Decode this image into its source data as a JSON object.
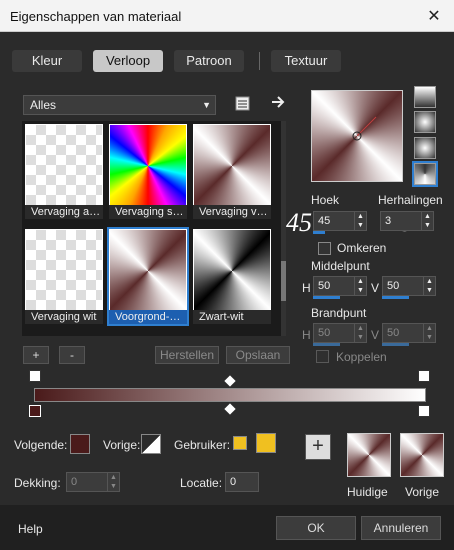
{
  "window": {
    "title": "Eigenschappen van materiaal",
    "close": "✕"
  },
  "tabs": [
    {
      "label": "Kleur"
    },
    {
      "label": "Verloop"
    },
    {
      "label": "Patroon"
    },
    {
      "label": "Textuur"
    }
  ],
  "category": {
    "selected": "Alles"
  },
  "gallery": [
    {
      "caption": "Vervaging a…"
    },
    {
      "caption": "Vervaging s…"
    },
    {
      "caption": "Vervaging v…"
    },
    {
      "caption": "Vervaging wit"
    },
    {
      "caption": "Voorgrond-…"
    },
    {
      "caption": "Zwart-wit"
    }
  ],
  "buttons": {
    "add": "+",
    "remove": "-",
    "restore": "Herstellen",
    "save": "Opslaan",
    "help": "Help",
    "ok": "OK",
    "cancel": "Annuleren",
    "add_big": "+"
  },
  "angle": {
    "label": "Hoek",
    "value": "45",
    "overlay": "45"
  },
  "repeats": {
    "label": "Herhalingen",
    "value": "3",
    "overlay": "3"
  },
  "invert": {
    "label": "Omkeren"
  },
  "center": {
    "label": "Middelpunt",
    "h_label": "H",
    "h_value": "50",
    "v_label": "V",
    "v_value": "50"
  },
  "focus": {
    "label": "Brandpunt",
    "h_label": "H",
    "h_value": "50",
    "v_label": "V",
    "v_value": "50",
    "link_label": "Koppelen"
  },
  "stops": {
    "next_label": "Volgende:",
    "prev_label": "Vorige:",
    "user_label": "Gebruiker:",
    "opacity_label": "Dekking:",
    "opacity_value": "0",
    "location_label": "Locatie:",
    "location_value": "0"
  },
  "thumbs": {
    "current": "Huidige",
    "previous": "Vorige"
  },
  "colors": {
    "accent": "#2f7fd0",
    "user": "#f0c020",
    "dark": "#4a1a1a"
  }
}
